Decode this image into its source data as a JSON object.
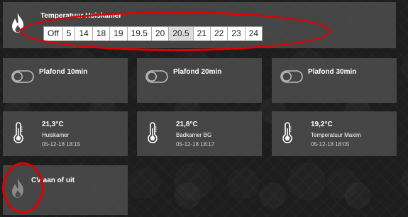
{
  "thermostat": {
    "title": "Temperatuur Huiskamer",
    "setpoints": [
      "Off",
      "5",
      "14",
      "18",
      "19",
      "19.5",
      "20",
      "20.5",
      "21",
      "22",
      "23",
      "24"
    ],
    "selected": "20.5",
    "icon": "flame-icon"
  },
  "switches": [
    {
      "label": "Plafond 10min",
      "icon": "toggle-off-icon"
    },
    {
      "label": "Plafond 20min",
      "icon": "toggle-off-icon"
    },
    {
      "label": "Plafond 30min",
      "icon": "toggle-off-icon"
    }
  ],
  "sensors": [
    {
      "value": "21,3°C",
      "name": "Huiskamer",
      "time": "05-12-18 18:15",
      "icon": "thermometer-icon"
    },
    {
      "value": "21,8°C",
      "name": "Badkamer BG",
      "time": "05-12-18 18:17",
      "icon": "thermometer-icon"
    },
    {
      "value": "19,2°C",
      "name": "Temperatuur Maxim",
      "time": "05-12-18 18:05",
      "icon": "thermometer-icon"
    }
  ],
  "cv": {
    "label": "CV aan of uit",
    "icon": "flame-icon"
  },
  "colors": {
    "tile_bg": "#4b4b4b",
    "annotation": "#e10000",
    "icon": "#ffffff",
    "icon_dim": "#8a8a8a"
  }
}
